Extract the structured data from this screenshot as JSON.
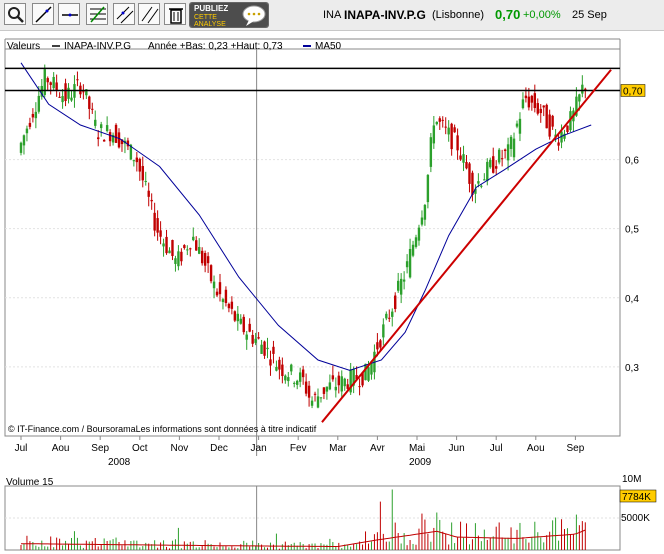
{
  "header": {
    "ticker_code": "INA",
    "name": "INAPA-INV.P.G",
    "exchange": "(Lisbonne)",
    "price": "0,70",
    "change": "+0,00%",
    "date": "25 Sep",
    "ad_line1": "PUBLIEZ",
    "ad_line2": "CETTE",
    "ad_line3": "ANALYSE"
  },
  "colors": {
    "up": "#2ca02c",
    "down": "#c00000",
    "ma": "#000099",
    "trend": "#cc0000",
    "price_green": "#009900",
    "price_box": "#ffcc00"
  },
  "chart_data": [
    {
      "type": "candlestick",
      "legend": {
        "label": "Valeurs",
        "series": "INAPA-INV.P.G",
        "range_text": "Année +Bas: 0,23 +Haut: 0,73",
        "ma_label": "MA50"
      },
      "y_ticks": [
        "0,3",
        "0,4",
        "0,5",
        "0,6"
      ],
      "y_range": [
        0.2,
        0.76
      ],
      "x_labels": [
        "Jul",
        "Aou",
        "Sep",
        "Oct",
        "Nov",
        "Dec",
        "Jan",
        "Fev",
        "Mar",
        "Avr",
        "Mai",
        "Jun",
        "Jul",
        "Aou",
        "Sep"
      ],
      "years": [
        "2008",
        "2009"
      ],
      "last_price_label": "0,70",
      "horizontal_lines": [
        0.732,
        0.7
      ],
      "trendline": {
        "from": [
          "Mar",
          0.22
        ],
        "to": [
          "Sep",
          0.73
        ]
      },
      "price_path": [
        [
          0,
          0.61
        ],
        [
          0.3,
          0.66
        ],
        [
          0.7,
          0.72
        ],
        [
          1.2,
          0.69
        ],
        [
          1.6,
          0.71
        ],
        [
          2.0,
          0.64
        ],
        [
          2.4,
          0.64
        ],
        [
          3.0,
          0.6
        ],
        [
          3.5,
          0.5
        ],
        [
          4.0,
          0.45
        ],
        [
          4.4,
          0.49
        ],
        [
          5.0,
          0.41
        ],
        [
          5.6,
          0.36
        ],
        [
          6.2,
          0.33
        ],
        [
          6.6,
          0.3
        ],
        [
          7.2,
          0.28
        ],
        [
          7.4,
          0.25
        ],
        [
          7.8,
          0.27
        ],
        [
          8.3,
          0.28
        ],
        [
          8.8,
          0.29
        ],
        [
          9.4,
          0.38
        ],
        [
          9.8,
          0.44
        ],
        [
          10.3,
          0.55
        ],
        [
          10.5,
          0.66
        ],
        [
          11.1,
          0.62
        ],
        [
          11.5,
          0.56
        ],
        [
          12.1,
          0.6
        ],
        [
          12.4,
          0.61
        ],
        [
          12.8,
          0.69
        ],
        [
          13.2,
          0.67
        ],
        [
          13.6,
          0.63
        ],
        [
          14.0,
          0.66
        ],
        [
          14.3,
          0.71
        ]
      ],
      "ma_path": [
        [
          0,
          0.74
        ],
        [
          0.7,
          0.68
        ],
        [
          1.5,
          0.65
        ],
        [
          2.5,
          0.63
        ],
        [
          3.5,
          0.59
        ],
        [
          4.5,
          0.52
        ],
        [
          5.5,
          0.43
        ],
        [
          6.5,
          0.36
        ],
        [
          7.5,
          0.31
        ],
        [
          8.3,
          0.295
        ],
        [
          9.1,
          0.31
        ],
        [
          9.7,
          0.35
        ],
        [
          10.2,
          0.41
        ],
        [
          10.8,
          0.49
        ],
        [
          11.5,
          0.56
        ],
        [
          12.2,
          0.585
        ],
        [
          13.0,
          0.615
        ],
        [
          13.7,
          0.635
        ],
        [
          14.4,
          0.65
        ]
      ],
      "copyright": "© IT-Finance.com / BoursoramaLes informations sont données à titre indicatif"
    },
    {
      "type": "bar",
      "label": "Volume 15",
      "y_ticks": [
        "10M",
        "5000K"
      ],
      "current_label": "7784K",
      "volume_profile": [
        [
          0,
          0.22
        ],
        [
          5,
          0.15
        ],
        [
          8,
          0.12
        ],
        [
          9.0,
          0.35
        ],
        [
          10.5,
          0.65
        ],
        [
          11.0,
          0.45
        ],
        [
          12.5,
          0.4
        ],
        [
          14.0,
          0.55
        ],
        [
          14.4,
          0.78
        ]
      ]
    }
  ]
}
